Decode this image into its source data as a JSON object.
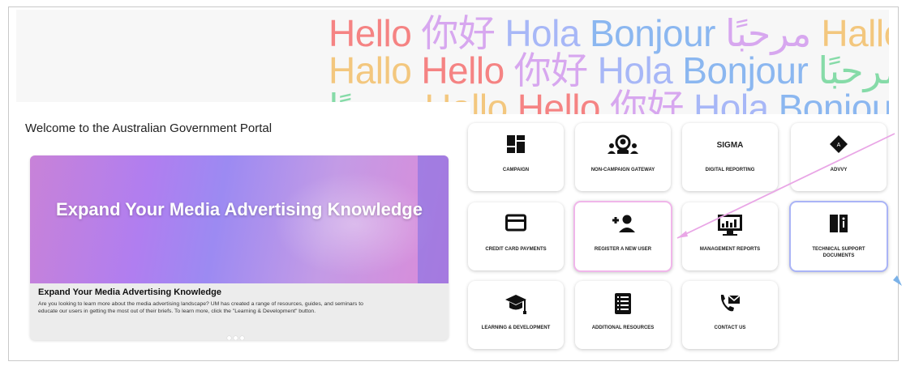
{
  "hero": {
    "lines": [
      [
        "Hello",
        "你好",
        "Hola",
        "Bonjour",
        "مرحبًا",
        "Hallo"
      ],
      [
        "Hallo",
        "Hello",
        "你好",
        "Hola",
        "Bonjour",
        "مرحبًا"
      ],
      [
        "مرحبًا",
        "Hallo",
        "Hello",
        "你好",
        "Hola",
        "Bonjour"
      ]
    ]
  },
  "welcome": "Welcome to the Australian Government Portal",
  "banner": {
    "image_title": "Expand Your Media Advertising Knowledge",
    "heading": "Expand Your Media Advertising Knowledge",
    "body": "Are you looking to learn more about the media advertising landscape? UM has created a range of resources, guides, and seminars to educate our users in getting the most out of their briefs. To learn more, click the \"Learning & Development\" button.",
    "slides": 3
  },
  "tiles": [
    {
      "label": "CAMPAIGN",
      "icon": "dashboard-icon"
    },
    {
      "label": "NON-CAMPAIGN GATEWAY",
      "icon": "network-user-icon"
    },
    {
      "label": "DIGITAL REPORTING",
      "icon": "sigma-logo",
      "logo_text": "SIGMA"
    },
    {
      "label": "ADVVY",
      "icon": "advvy-diamond-icon"
    },
    {
      "label": "CREDIT CARD PAYMENTS",
      "icon": "credit-card-icon"
    },
    {
      "label": "REGISTER A NEW USER",
      "icon": "add-user-icon"
    },
    {
      "label": "MANAGEMENT REPORTS",
      "icon": "chart-monitor-icon"
    },
    {
      "label": "TECHNICAL SUPPORT DOCUMENTS",
      "icon": "book-info-icon"
    },
    {
      "label": "LEARNING & DEVELOPMENT",
      "icon": "graduation-cap-icon"
    },
    {
      "label": "ADDITIONAL RESOURCES",
      "icon": "document-list-icon"
    },
    {
      "label": "CONTACT US",
      "icon": "phone-icon"
    }
  ],
  "colors": {
    "highlight_pink": "#f0b6ea",
    "highlight_blue": "#aab4f6",
    "arrow_pink": "#e9a6e6",
    "arrow_blue": "#7bb2e8"
  }
}
